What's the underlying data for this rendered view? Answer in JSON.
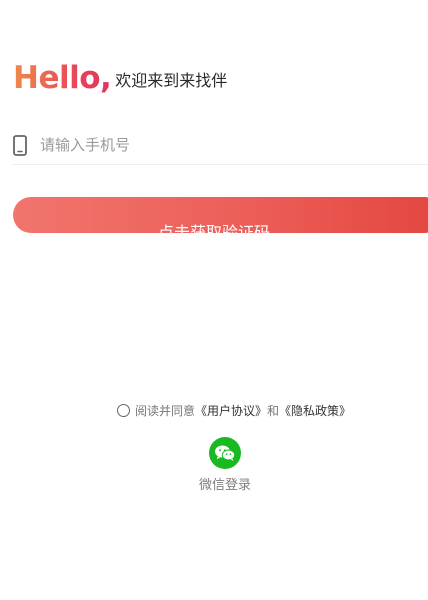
{
  "header": {
    "hello": "Hello,",
    "welcome": "欢迎来到来找伴"
  },
  "login_form": {
    "phone_placeholder": "请输入手机号",
    "phone_value": "",
    "submit_label": "点击获取验证码"
  },
  "agreement": {
    "prefix": "阅读并同意",
    "user_agreement": "《用户协议》",
    "conjunction": "和",
    "privacy_policy": "《隐私政策》",
    "checked": false
  },
  "third_party": {
    "wechat_label": "微信登录"
  },
  "colors": {
    "accent_start": "#f1756d",
    "accent_end": "#e3463f",
    "wechat_green": "#19ba21"
  },
  "icons": {
    "phone": "phone-icon",
    "wechat": "wechat-icon",
    "radio": "radio-unchecked-icon"
  }
}
